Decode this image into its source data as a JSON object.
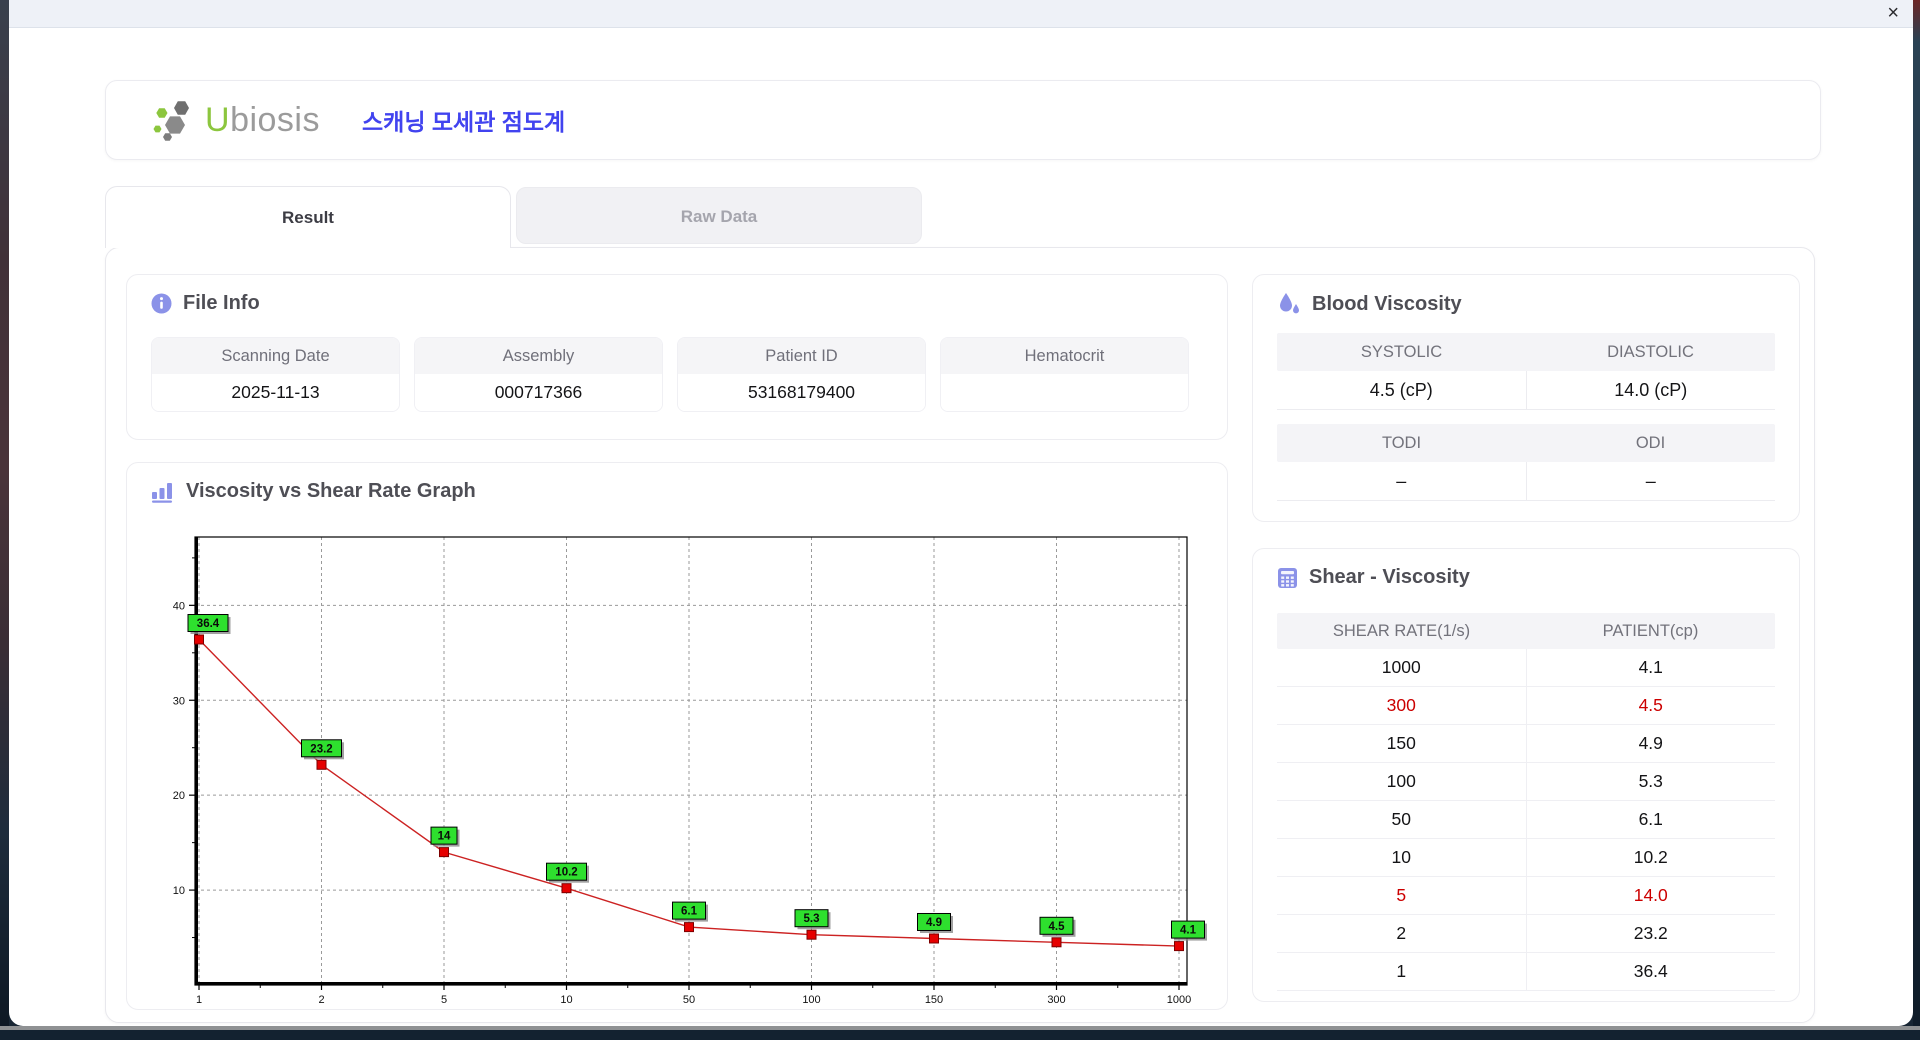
{
  "titlebar": {
    "close_icon": "×"
  },
  "brand": {
    "logo_text_accent": "U",
    "logo_text_rest": "biosis",
    "app_title_ko": "스캐닝 모세관 점도계"
  },
  "tabs": {
    "result": "Result",
    "raw_data": "Raw Data",
    "active": "Result"
  },
  "file_info": {
    "title": "File Info",
    "fields": [
      {
        "label": "Scanning Date",
        "value": "2025-11-13"
      },
      {
        "label": "Assembly",
        "value": "000717366"
      },
      {
        "label": "Patient ID",
        "value": "53168179400"
      },
      {
        "label": "Hematocrit",
        "value": ""
      }
    ]
  },
  "blood_viscosity": {
    "title": "Blood Viscosity",
    "groups": [
      {
        "cells": [
          {
            "label": "SYSTOLIC",
            "value": "4.5 (cP)"
          },
          {
            "label": "DIASTOLIC",
            "value": "14.0 (cP)"
          }
        ]
      },
      {
        "cells": [
          {
            "label": "TODI",
            "value": "–"
          },
          {
            "label": "ODI",
            "value": "–"
          }
        ]
      }
    ]
  },
  "graph_section": {
    "title": "Viscosity vs Shear Rate Graph"
  },
  "shear_viscosity": {
    "title": "Shear - Viscosity",
    "headers": [
      "SHEAR RATE(1/s)",
      "PATIENT(cp)"
    ],
    "highlight_color": "#cc0000",
    "rows": [
      {
        "shear": "1000",
        "patient": "4.1",
        "highlight": false
      },
      {
        "shear": "300",
        "patient": "4.5",
        "highlight": true
      },
      {
        "shear": "150",
        "patient": "4.9",
        "highlight": false
      },
      {
        "shear": "100",
        "patient": "5.3",
        "highlight": false
      },
      {
        "shear": "50",
        "patient": "6.1",
        "highlight": false
      },
      {
        "shear": "10",
        "patient": "10.2",
        "highlight": false
      },
      {
        "shear": "5",
        "patient": "14.0",
        "highlight": true
      },
      {
        "shear": "2",
        "patient": "23.2",
        "highlight": false
      },
      {
        "shear": "1",
        "patient": "36.4",
        "highlight": false
      }
    ]
  },
  "chart_data": {
    "type": "line",
    "title": "Viscosity vs Shear Rate Graph",
    "xlabel": "",
    "ylabel": "",
    "x_categories": [
      "1",
      "2",
      "5",
      "10",
      "50",
      "100",
      "150",
      "300",
      "1000"
    ],
    "values": [
      36.4,
      23.2,
      14,
      10.2,
      6.1,
      5.3,
      4.9,
      4.5,
      4.1
    ],
    "point_labels": [
      "36.4",
      "23.2",
      "14",
      "10.2",
      "6.1",
      "5.3",
      "4.9",
      "4.5",
      "4.1"
    ],
    "y_ticks": [
      10,
      20,
      30,
      40
    ],
    "y_minor_ticks": [
      5,
      15,
      25,
      35,
      45
    ],
    "ylim": [
      0,
      47.2
    ],
    "x_axis_style": "categorical (log-spaced shear rates), evenly spaced ticks",
    "grid": "dashed gray, vertical at every x tick and horizontal at every y tick",
    "legend": "none",
    "line_color": "#cc2222",
    "marker_color": "#e60000",
    "marker_shape": "square",
    "point_label_bg": "#2ee02e"
  }
}
